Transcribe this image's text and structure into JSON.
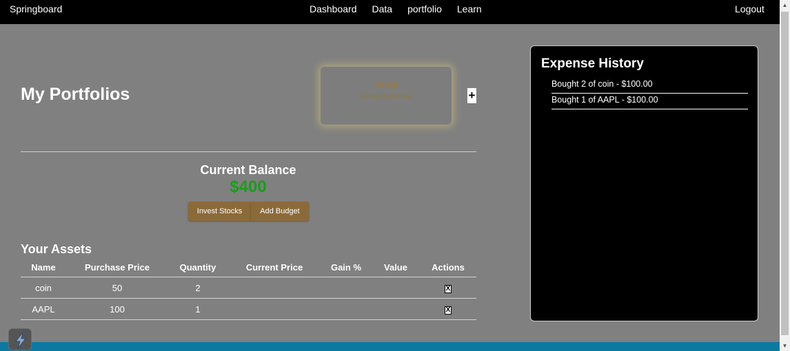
{
  "nav": {
    "brand": "Springboard",
    "links": [
      "Dashboard",
      "Data",
      "portfolio",
      "Learn"
    ],
    "logout": "Logout"
  },
  "page": {
    "title": "My Portfolios"
  },
  "portfolio_card": {
    "name": "Green",
    "description": "Green Environ"
  },
  "add_portfolio": {
    "label": "+"
  },
  "balance": {
    "label": "Current Balance",
    "value": "$400"
  },
  "buttons": {
    "invest": "Invest Stocks",
    "add_budget": "Add Budget"
  },
  "assets": {
    "title": "Your Assets",
    "columns": [
      "Name",
      "Purchase Price",
      "Quantity",
      "Current Price",
      "Gain %",
      "Value",
      "Actions"
    ],
    "rows": [
      {
        "name": "coin",
        "purchase_price": "50",
        "quantity": "2",
        "current_price": "",
        "gain": "",
        "value": "",
        "action": "X"
      },
      {
        "name": "AAPL",
        "purchase_price": "100",
        "quantity": "1",
        "current_price": "",
        "gain": "",
        "value": "",
        "action": "X"
      }
    ]
  },
  "expense_history": {
    "title": "Expense History",
    "items": [
      "Bought 2 of coin - $100.00",
      "Bought 1 of AAPL - $100.00"
    ]
  },
  "scrollbar": {
    "up_icon": "▲",
    "down_icon": "▼"
  },
  "colors": {
    "balance": "#1e9a1e",
    "button": "#8b6a3a",
    "footer": "#0c7aa0"
  },
  "icons": {
    "widget": "lightning-bolt-icon"
  }
}
